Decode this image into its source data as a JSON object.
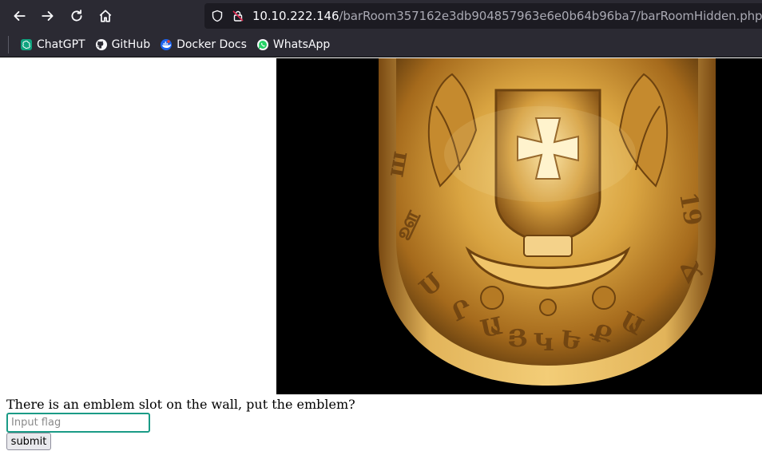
{
  "browser": {
    "url_host": "10.10.222.146",
    "url_path": "/barRoom357162e3db904857963e6e0b64b96ba7/barRoomHidden.php"
  },
  "bookmarks": [
    {
      "label": "ChatGPT",
      "icon": "chatgpt-icon"
    },
    {
      "label": "GitHub",
      "icon": "github-icon"
    },
    {
      "label": "Docker Docs",
      "icon": "docker-icon"
    },
    {
      "label": "WhatsApp",
      "icon": "whatsapp-icon"
    }
  ],
  "page": {
    "image": {
      "icon": "emblem-image"
    },
    "prompt": "There is an emblem slot on the wall, put the emblem?",
    "input_placeholder": "Input flag",
    "input_value": "",
    "submit_label": "submit"
  },
  "colors": {
    "chrome_bg": "#2b2a33",
    "urlbar_bg": "#1c1b22",
    "input_focus_border": "#1a9b86"
  }
}
